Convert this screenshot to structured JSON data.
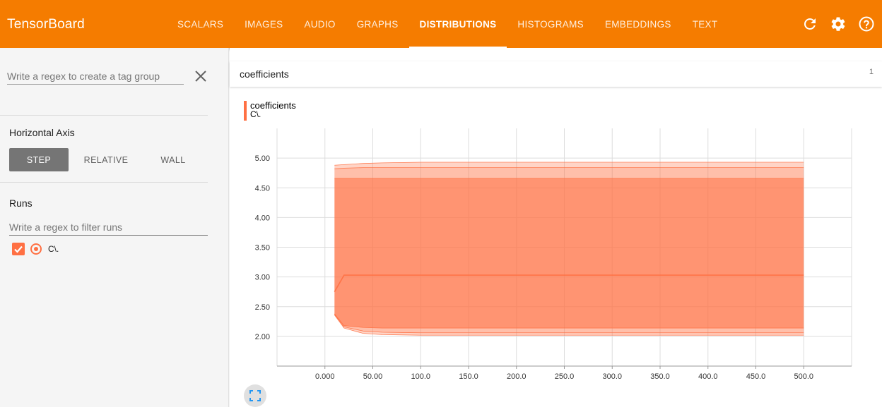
{
  "app": {
    "title": "TensorBoard"
  },
  "tabs": [
    {
      "label": "SCALARS",
      "active": false
    },
    {
      "label": "IMAGES",
      "active": false
    },
    {
      "label": "AUDIO",
      "active": false
    },
    {
      "label": "GRAPHS",
      "active": false
    },
    {
      "label": "DISTRIBUTIONS",
      "active": true
    },
    {
      "label": "HISTOGRAMS",
      "active": false
    },
    {
      "label": "EMBEDDINGS",
      "active": false
    },
    {
      "label": "TEXT",
      "active": false
    }
  ],
  "toolbar": {
    "icons": [
      "refresh-icon",
      "settings-icon",
      "help-icon"
    ]
  },
  "sidebar": {
    "tag_group_placeholder": "Write a regex to create a tag group",
    "horizontal_axis_title": "Horizontal Axis",
    "axis_options": [
      "STEP",
      "RELATIVE",
      "WALL"
    ],
    "axis_selected": "STEP",
    "runs_title": "Runs",
    "runs_filter_placeholder": "Write a regex to filter runs",
    "runs": [
      {
        "name": "C\\.",
        "checked": true,
        "selected": true
      }
    ]
  },
  "card": {
    "title": "coefficients",
    "count": "1",
    "plot_tag": "coefficients",
    "plot_run": "C\\."
  },
  "colors": {
    "accent": "#f57c00",
    "run": "#ff7043"
  },
  "chart_data": {
    "type": "area",
    "xlim": [
      -50,
      550
    ],
    "ylim": [
      1.5,
      5.5
    ],
    "x_ticks": [
      "0.000",
      "50.00",
      "100.0",
      "150.0",
      "200.0",
      "250.0",
      "300.0",
      "350.0",
      "400.0",
      "450.0",
      "500.0"
    ],
    "x_tick_values": [
      0,
      50,
      100,
      150,
      200,
      250,
      300,
      350,
      400,
      450,
      500
    ],
    "y_ticks": [
      "2.00",
      "2.50",
      "3.00",
      "3.50",
      "4.00",
      "4.50",
      "5.00"
    ],
    "y_tick_values": [
      2.0,
      2.5,
      3.0,
      3.5,
      4.0,
      4.5,
      5.0
    ],
    "x": [
      10,
      20,
      40,
      60,
      100,
      200,
      500
    ],
    "series": [
      {
        "values": [
          4.88,
          4.89,
          4.91,
          4.92,
          4.93,
          4.93,
          4.93
        ]
      },
      {
        "values": [
          4.82,
          4.83,
          4.84,
          4.84,
          4.84,
          4.84,
          4.84
        ]
      },
      {
        "values": [
          4.66,
          4.66,
          4.66,
          4.66,
          4.66,
          4.66,
          4.66
        ]
      },
      {
        "values": [
          2.75,
          3.03,
          3.03,
          3.03,
          3.03,
          3.03,
          3.03
        ]
      },
      {
        "values": [
          2.38,
          2.18,
          2.15,
          2.14,
          2.14,
          2.14,
          2.14
        ]
      },
      {
        "values": [
          2.37,
          2.16,
          2.09,
          2.07,
          2.06,
          2.06,
          2.06
        ]
      },
      {
        "values": [
          2.36,
          2.14,
          2.05,
          2.03,
          2.02,
          2.02,
          2.02
        ]
      }
    ]
  }
}
